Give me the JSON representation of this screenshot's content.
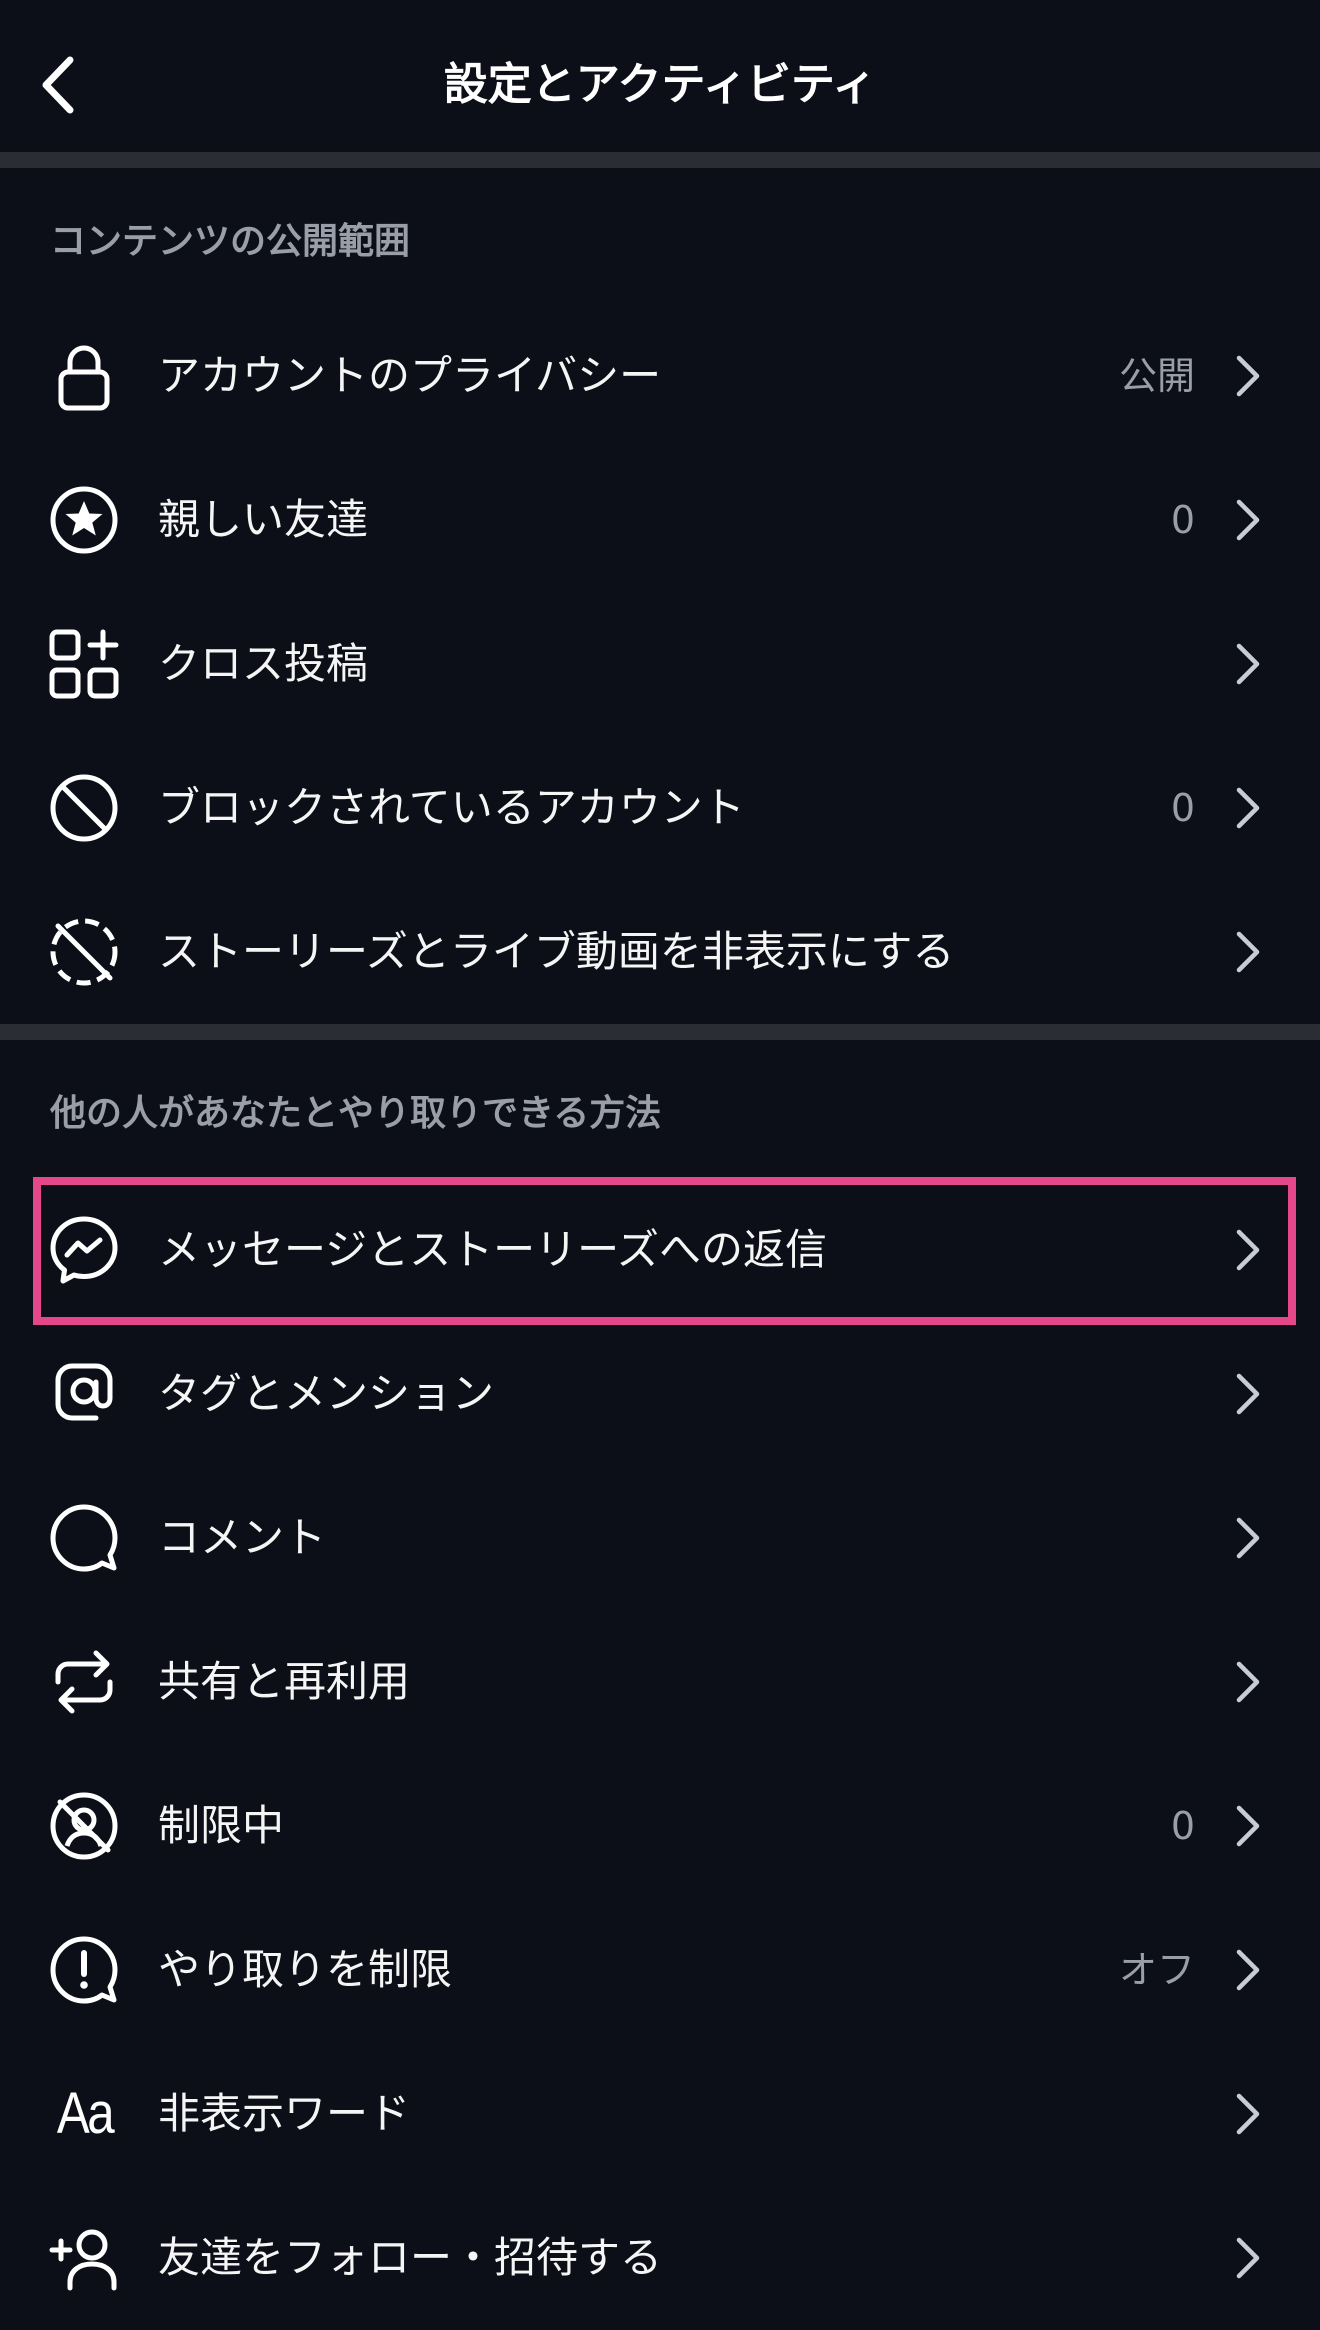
{
  "header": {
    "title": "設定とアクティビティ"
  },
  "sections": [
    {
      "title": "コンテンツの公開範囲",
      "items": [
        {
          "label": "アカウントのプライバシー",
          "value": "公開",
          "icon": "lock-icon"
        },
        {
          "label": "親しい友達",
          "value": "0",
          "icon": "star-circle-icon"
        },
        {
          "label": "クロス投稿",
          "value": "",
          "icon": "grid-plus-icon"
        },
        {
          "label": "ブロックされているアカウント",
          "value": "0",
          "icon": "block-icon"
        },
        {
          "label": "ストーリーズとライブ動画を非表示にする",
          "value": "",
          "icon": "story-hide-icon"
        }
      ]
    },
    {
      "title": "他の人があなたとやり取りできる方法",
      "items": [
        {
          "label": "メッセージとストーリーズへの返信",
          "value": "",
          "icon": "messenger-icon"
        },
        {
          "label": "タグとメンション",
          "value": "",
          "icon": "at-icon"
        },
        {
          "label": "コメント",
          "value": "",
          "icon": "comment-icon"
        },
        {
          "label": "共有と再利用",
          "value": "",
          "icon": "repeat-icon"
        },
        {
          "label": "制限中",
          "value": "0",
          "icon": "restricted-icon"
        },
        {
          "label": "やり取りを制限",
          "value": "オフ",
          "icon": "limit-interactions-icon"
        },
        {
          "label": "非表示ワード",
          "value": "",
          "icon": "hidden-words-icon",
          "icon_text": "Aa"
        },
        {
          "label": "友達をフォロー・招待する",
          "value": "",
          "icon": "add-person-icon"
        }
      ]
    }
  ],
  "colors": {
    "background": "#0c0f17",
    "divider": "#2a2d34",
    "highlight": "#e4488a",
    "secondary_text": "#9a9ea8"
  }
}
